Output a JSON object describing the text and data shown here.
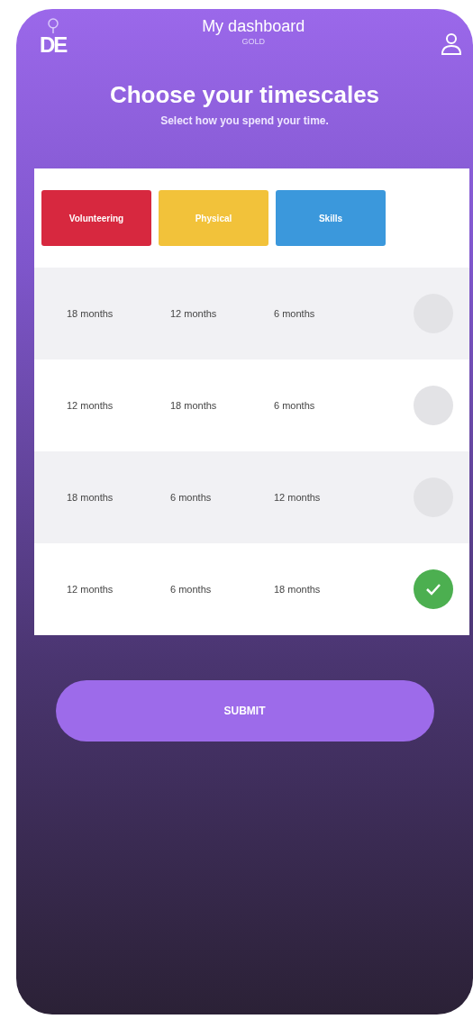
{
  "header": {
    "logo": "DE",
    "title": "My dashboard",
    "subtitle": "GOLD"
  },
  "heading": "Choose your timescales",
  "intro": "Select how you spend your time.",
  "columns": [
    {
      "label": "Volunteering",
      "color": "#d7283f"
    },
    {
      "label": "Physical",
      "color": "#f2c23a"
    },
    {
      "label": "Skills",
      "color": "#3b98dc"
    }
  ],
  "rows": [
    {
      "cells": [
        "18 months",
        "12 months",
        "6 months"
      ],
      "selected": false
    },
    {
      "cells": [
        "12 months",
        "18 months",
        "6 months"
      ],
      "selected": false
    },
    {
      "cells": [
        "18 months",
        "6 months",
        "12 months"
      ],
      "selected": false
    },
    {
      "cells": [
        "12 months",
        "6 months",
        "18 months"
      ],
      "selected": true
    }
  ],
  "submit": "SUBMIT"
}
